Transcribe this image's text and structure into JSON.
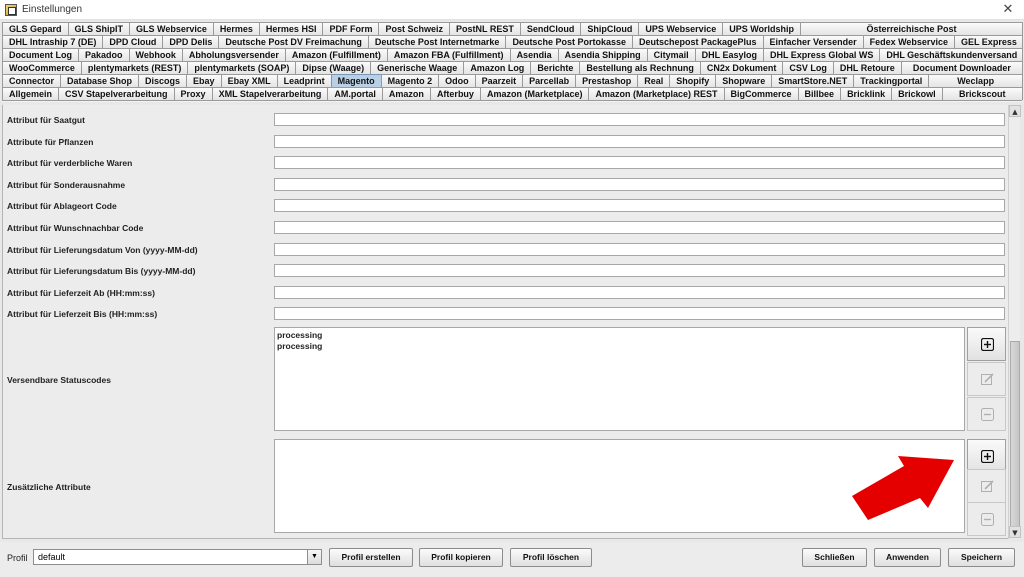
{
  "window": {
    "title": "Einstellungen",
    "close": "✕"
  },
  "tabs": {
    "rows": [
      [
        "GLS Gepard",
        "GLS ShipIT",
        "GLS Webservice",
        "Hermes",
        "Hermes HSI",
        "PDF Form",
        "Post Schweiz",
        "PostNL REST",
        "SendCloud",
        "ShipCloud",
        "UPS Webservice",
        "UPS Worldship",
        "Österreichische Post"
      ],
      [
        "DHL Intraship 7 (DE)",
        "DPD Cloud",
        "DPD Delis",
        "Deutsche Post DV Freimachung",
        "Deutsche Post Internetmarke",
        "Deutsche Post Portokasse",
        "Deutschepost PackagePlus",
        "Einfacher Versender",
        "Fedex Webservice",
        "GEL Express"
      ],
      [
        "Document Log",
        "Pakadoo",
        "Webhook",
        "Abholungsversender",
        "Amazon (Fulfillment)",
        "Amazon FBA (Fulfillment)",
        "Asendia",
        "Asendia Shipping",
        "Citymail",
        "DHL Easylog",
        "DHL Express Global WS",
        "DHL Geschäftskundenversand"
      ],
      [
        "WooCommerce",
        "plentymarkets (REST)",
        "plentymarkets (SOAP)",
        "Dipse (Waage)",
        "Generische Waage",
        "Amazon Log",
        "Berichte",
        "Bestellung als Rechnung",
        "CN2x Dokument",
        "CSV Log",
        "DHL Retoure",
        "Document Downloader"
      ],
      [
        "Connector",
        "Database Shop",
        "Discogs",
        "Ebay",
        "Ebay XML",
        "Leadprint",
        "Magento",
        "Magento 2",
        "Odoo",
        "Paarzeit",
        "Parcellab",
        "Prestashop",
        "Real",
        "Shopify",
        "Shopware",
        "SmartStore.NET",
        "Trackingportal",
        "Weclapp"
      ],
      [
        "Allgemein",
        "CSV Stapelverarbeitung",
        "Proxy",
        "XML Stapelverarbeitung",
        "AM.portal",
        "Amazon",
        "Afterbuy",
        "Amazon (Marketplace)",
        "Amazon (Marketplace) REST",
        "BigCommerce",
        "Billbee",
        "Bricklink",
        "Brickowl",
        "Brickscout"
      ]
    ],
    "selected": "Magento"
  },
  "form": {
    "fields": [
      {
        "label": "Attribut für Saatgut",
        "value": ""
      },
      {
        "label": "Attribute für Pflanzen",
        "value": ""
      },
      {
        "label": "Attribut für verderbliche Waren",
        "value": ""
      },
      {
        "label": "Attribut für Sonderausnahme",
        "value": ""
      },
      {
        "label": "Attribut für Ablageort Code",
        "value": ""
      },
      {
        "label": "Attribut für Wunschnachbar Code",
        "value": ""
      },
      {
        "label": "Attribut für Lieferungsdatum Von (yyyy-MM-dd)",
        "value": ""
      },
      {
        "label": "Attribut für Lieferungsdatum Bis (yyyy-MM-dd)",
        "value": ""
      },
      {
        "label": "Attribut für Lieferzeit Ab (HH:mm:ss)",
        "value": ""
      },
      {
        "label": "Attribut für Lieferzeit Bis (HH:mm:ss)",
        "value": ""
      }
    ],
    "status_codes": {
      "label": "Versendbare Statuscodes",
      "items": [
        "processing",
        "processing"
      ]
    },
    "extra_attributes": {
      "label": "Zusätzliche Attribute",
      "items": []
    }
  },
  "icons": {
    "add": "plus-icon",
    "edit": "edit-icon",
    "remove": "minus-icon"
  },
  "bottom": {
    "profile_label": "Profil",
    "profile_value": "default",
    "buttons": {
      "create": "Profil erstellen",
      "copy": "Profil kopieren",
      "delete": "Profil löschen",
      "close": "Schließen",
      "apply": "Anwenden",
      "save": "Speichern"
    }
  },
  "colors": {
    "selected_tab": "#b8cfe5",
    "annotation_arrow": "#e50000"
  }
}
